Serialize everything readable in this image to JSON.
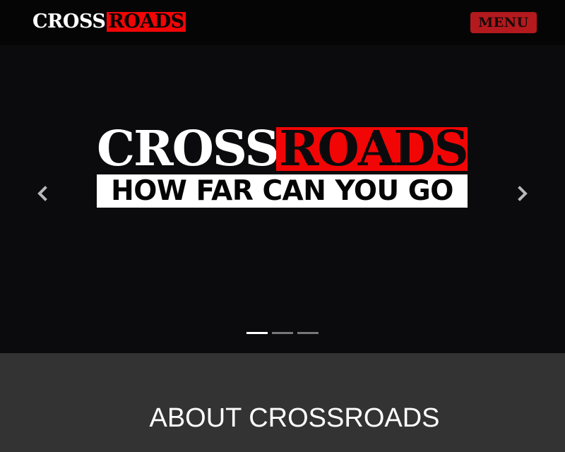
{
  "navbar": {
    "brand_white": "CROSS",
    "brand_red": "ROADS",
    "menu_label": "MENU"
  },
  "hero": {
    "logo_white": "CROSS",
    "logo_red": "ROADS",
    "tagline": "HOW FAR CAN YOU GO",
    "prev_icon": "chevron-left-icon",
    "next_icon": "chevron-right-icon",
    "slide_count": 3,
    "active_slide": 1
  },
  "about": {
    "title": "ABOUT CROSSROADS"
  },
  "colors": {
    "nav_bg": "#050505",
    "brand_red": "#f20505",
    "menu_button_bg": "#b3191d",
    "hero_bg": "#0b0b0d",
    "about_bg": "#333333",
    "text_white": "#ffffff"
  }
}
